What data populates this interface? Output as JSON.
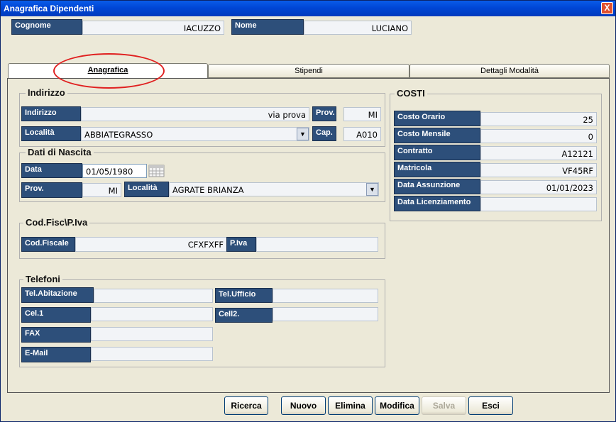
{
  "window": {
    "title": "Anagrafica Dipendenti",
    "close_glyph": "X"
  },
  "header": {
    "cognome_label": "Cognome",
    "cognome_value": "IACUZZO",
    "nome_label": "Nome",
    "nome_value": "LUCIANO"
  },
  "tabs": [
    {
      "label": "Anagrafica",
      "active": true
    },
    {
      "label": "Stipendi",
      "active": false
    },
    {
      "label": "Dettagli Modalità",
      "active": false
    }
  ],
  "indirizzo": {
    "title": "Indirizzo",
    "indirizzo_label": "Indirizzo",
    "indirizzo_value": "via prova",
    "prov_label": "Prov.",
    "prov_value": "MI",
    "localita_label": "Località",
    "localita_value": "ABBIATEGRASSO",
    "cap_label": "Cap.",
    "cap_value": "A010"
  },
  "nascita": {
    "title": "Dati di Nascita",
    "data_label": "Data",
    "data_value": "01/05/1980",
    "prov_label": "Prov.",
    "prov_value": "MI",
    "localita_label": "Località",
    "localita_value": "AGRATE BRIANZA"
  },
  "fiscale": {
    "title": "Cod.Fisc\\P.Iva",
    "codfiscale_label": "Cod.Fiscale",
    "codfiscale_value": "CFXFXFF",
    "piva_label": "P.Iva",
    "piva_value": ""
  },
  "telefoni": {
    "title": "Telefoni",
    "abitazione_label": "Tel.Abitazione",
    "abitazione_value": "",
    "ufficio_label": "Tel.Ufficio",
    "ufficio_value": "",
    "cel1_label": "Cel.1",
    "cel1_value": "",
    "cel2_label": "Cell2.",
    "cel2_value": "",
    "fax_label": "FAX",
    "fax_value": "",
    "email_label": "E-Mail",
    "email_value": ""
  },
  "costi": {
    "title": "COSTI",
    "costo_orario_label": "Costo Orario",
    "costo_orario_value": "25",
    "costo_mensile_label": "Costo Mensile",
    "costo_mensile_value": "0",
    "contratto_label": "Contratto",
    "contratto_value": "A12121",
    "matricola_label": "Matricola",
    "matricola_value": "VF45RF",
    "assunzione_label": "Data Assunzione",
    "assunzione_value": "01/01/2023",
    "licenziamento_label": "Data Licenziamento",
    "licenziamento_value": ""
  },
  "buttons": {
    "ricerca": "Ricerca",
    "nuovo": "Nuovo",
    "elimina": "Elimina",
    "modifica": "Modifica",
    "salva": "Salva",
    "esci": "Esci"
  },
  "colors": {
    "label_bg": "#2d4f7a",
    "highlight_circle": "#e02020",
    "titlebar": "#0046d5"
  }
}
